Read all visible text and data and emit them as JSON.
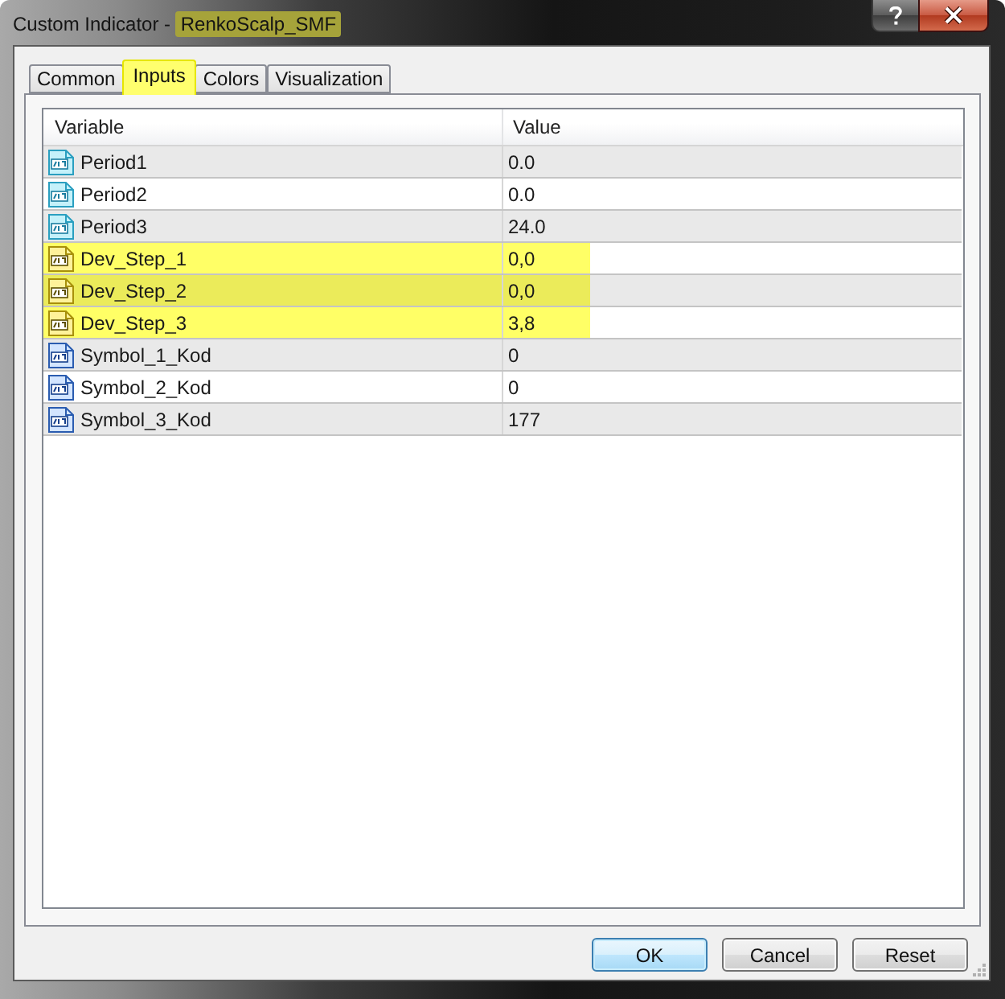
{
  "window": {
    "title": [
      {
        "text": "Custom Indicator - ",
        "highlighted": false
      },
      {
        "text": "RenkoScalp_SMF",
        "highlighted": true
      }
    ]
  },
  "tabs": [
    {
      "label": "Common",
      "selected": false,
      "highlighted": false
    },
    {
      "label": "Inputs",
      "selected": true,
      "highlighted": true
    },
    {
      "label": "Colors",
      "selected": false,
      "highlighted": false
    },
    {
      "label": "Visualization",
      "selected": false,
      "highlighted": false
    }
  ],
  "table": {
    "columns": [
      "Variable",
      "Value"
    ],
    "rows": [
      {
        "kind": "double",
        "variable": "Period1",
        "value": "0.0",
        "highlighted": false
      },
      {
        "kind": "double",
        "variable": "Period2",
        "value": "0.0",
        "highlighted": false
      },
      {
        "kind": "double",
        "variable": "Period3",
        "value": "24.0",
        "highlighted": false
      },
      {
        "kind": "string",
        "variable": "Dev_Step_1",
        "value": "0,0",
        "highlighted": true
      },
      {
        "kind": "string",
        "variable": "Dev_Step_2",
        "value": "0,0",
        "highlighted": true
      },
      {
        "kind": "string",
        "variable": "Dev_Step_3",
        "value": "3,8",
        "highlighted": true
      },
      {
        "kind": "integer",
        "variable": "Symbol_1_Kod",
        "value": "0",
        "highlighted": false
      },
      {
        "kind": "integer",
        "variable": "Symbol_2_Kod",
        "value": "0",
        "highlighted": false
      },
      {
        "kind": "integer",
        "variable": "Symbol_3_Kod",
        "value": "177",
        "highlighted": false
      }
    ]
  },
  "buttons": [
    {
      "label": "OK",
      "default": true
    },
    {
      "label": "Cancel",
      "default": false
    },
    {
      "label": "Reset",
      "default": false
    }
  ]
}
